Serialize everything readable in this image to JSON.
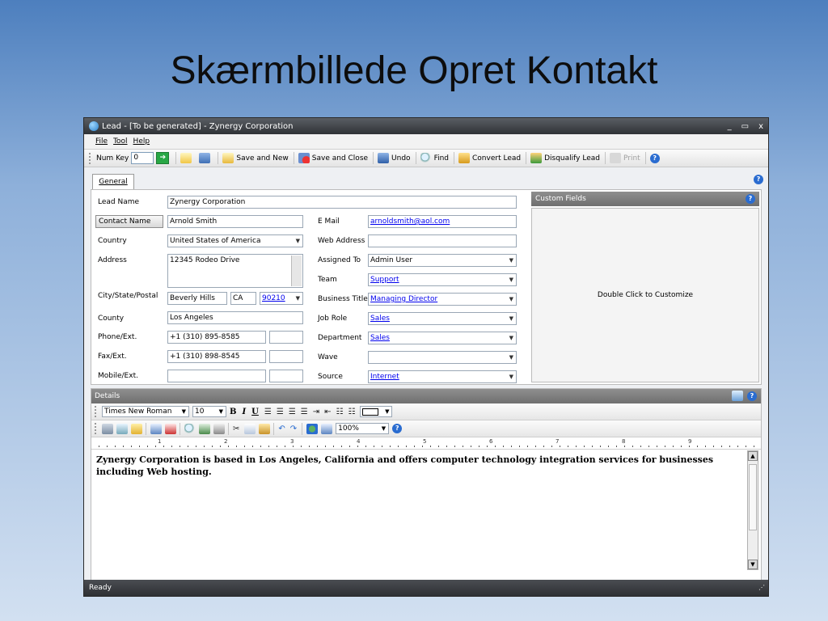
{
  "slide": {
    "title": "Skærmbillede Opret Kontakt"
  },
  "window": {
    "title": "Lead - [To be generated] - Zynergy Corporation",
    "controls": [
      "_",
      "▭",
      "x"
    ]
  },
  "menu": [
    "File",
    "Tool",
    "Help"
  ],
  "toolbar": {
    "numkey_label": "Num Key",
    "numkey_value": "0",
    "save_new": "Save and New",
    "save_close": "Save and Close",
    "undo": "Undo",
    "find": "Find",
    "convert": "Convert Lead",
    "disqualify": "Disqualify Lead",
    "print": "Print"
  },
  "tabs": [
    "General"
  ],
  "form": {
    "lead_name_label": "Lead Name",
    "lead_name": "Zynergy Corporation",
    "contact_name_label": "Contact Name",
    "contact_name": "Arnold Smith",
    "country_label": "Country",
    "country": "United States of America",
    "address_label": "Address",
    "address": "12345 Rodeo Drive",
    "city_label": "City/State/Postal",
    "city": "Beverly Hills",
    "state": "CA",
    "postal": "90210",
    "county_label": "County",
    "county": "Los Angeles",
    "phone_label": "Phone/Ext.",
    "phone": "+1 (310) 895-8585",
    "fax_label": "Fax/Ext.",
    "fax": "+1 (310) 898-8545",
    "mobile_label": "Mobile/Ext.",
    "email_label": "E Mail",
    "email": "arnoldsmith@aol.com",
    "web_label": "Web Address",
    "assigned_label": "Assigned To",
    "assigned": "Admin User",
    "team_label": "Team",
    "team": "Support",
    "btitle_label": "Business Title",
    "btitle": "Managing Director",
    "jobrole_label": "Job Role",
    "jobrole": "Sales",
    "dept_label": "Department",
    "dept": "Sales",
    "wave_label": "Wave",
    "source_label": "Source",
    "source": "Internet"
  },
  "custom_fields": {
    "title": "Custom Fields",
    "hint": "Double Click to Customize"
  },
  "details": {
    "title": "Details",
    "font": "Times New Roman",
    "size": "10",
    "zoom": "100%",
    "ruler_marks": [
      "1",
      "2",
      "3",
      "4",
      "5",
      "6",
      "7",
      "8",
      "9"
    ],
    "text": "Zynergy Corporation is based in Los Angeles, California and offers computer technology integration services for businesses including Web hosting."
  },
  "status": "Ready",
  "colors": {
    "accent": "#2a6cd0",
    "link": "#0000ee",
    "titlebar": "#3a3d42"
  }
}
